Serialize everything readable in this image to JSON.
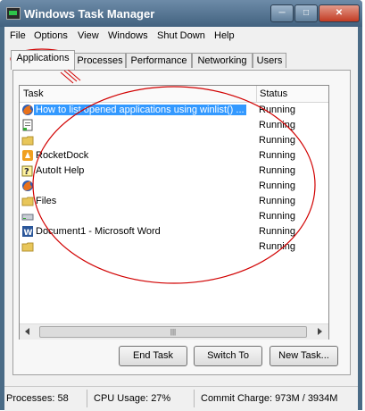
{
  "window": {
    "title": "Windows Task Manager",
    "minimize_glyph": "─",
    "maximize_glyph": "□",
    "close_glyph": "✕"
  },
  "menu": [
    "File",
    "Options",
    "View",
    "Windows",
    "Shut Down",
    "Help"
  ],
  "tabs": [
    "Applications",
    "Processes",
    "Performance",
    "Networking",
    "Users"
  ],
  "active_tab": "Applications",
  "columns": {
    "task": "Task",
    "status": "Status"
  },
  "tasks": [
    {
      "name": "How to list opened applications using winlist() ...",
      "status": "Running",
      "icon": "firefox-icon",
      "selected": true
    },
    {
      "name": "",
      "status": "Running",
      "icon": "document-icon",
      "selected": false
    },
    {
      "name": "",
      "status": "Running",
      "icon": "folder-icon",
      "selected": false
    },
    {
      "name": "RocketDock",
      "status": "Running",
      "icon": "rocketdock-icon",
      "selected": false
    },
    {
      "name": "AutoIt Help",
      "status": "Running",
      "icon": "help-icon",
      "selected": false
    },
    {
      "name": "",
      "status": "Running",
      "icon": "firefox-icon",
      "selected": false
    },
    {
      "name": "Files",
      "status": "Running",
      "icon": "folder-icon",
      "selected": false
    },
    {
      "name": "",
      "status": "Running",
      "icon": "drive-icon",
      "selected": false
    },
    {
      "name": "Document1 - Microsoft Word",
      "status": "Running",
      "icon": "word-icon",
      "selected": false
    },
    {
      "name": "",
      "status": "Running",
      "icon": "folder-icon",
      "selected": false
    }
  ],
  "buttons": {
    "end_task": "End Task",
    "switch_to": "Switch To",
    "new_task": "New Task..."
  },
  "statusbar": {
    "processes": "Processes: 58",
    "cpu": "CPU Usage: 27%",
    "commit": "Commit Charge: 973M / 3934M"
  },
  "colors": {
    "selection": "#3399ff",
    "annotation": "#d10000",
    "titlebar": "#4f7090"
  }
}
